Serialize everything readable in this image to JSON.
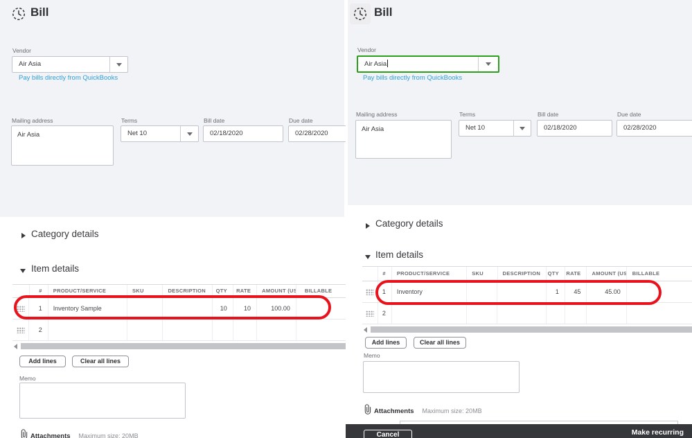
{
  "colors": {
    "highlight_red": "#e8121d",
    "focus_green": "#2ca01c",
    "link_blue": "#2f9fd9",
    "footer_bg": "#36373b",
    "panel_gray": "#f2f3f7"
  },
  "left": {
    "title": "Bill",
    "vendor_label": "Vendor",
    "vendor_value": "Air Asia",
    "pay_link": "Pay bills directly from QuickBooks",
    "mailing_label": "Mailing address",
    "mailing_value": "Air Asia",
    "terms_label": "Terms",
    "terms_value": "Net 10",
    "bill_date_label": "Bill date",
    "bill_date_value": "02/18/2020",
    "due_date_label": "Due date",
    "due_date_value": "02/28/2020",
    "category_details": "Category details",
    "item_details": "Item details",
    "table": {
      "headers": [
        "#",
        "PRODUCT/SERVICE",
        "SKU",
        "DESCRIPTION",
        "QTY",
        "RATE",
        "AMOUNT (US",
        "BILLABLE"
      ],
      "rows": [
        {
          "num": "1",
          "product": "Inventory Sample",
          "sku": "",
          "description": "",
          "qty": "10",
          "rate": "10",
          "amount": "100.00",
          "billable": ""
        },
        {
          "num": "2",
          "product": "",
          "sku": "",
          "description": "",
          "qty": "",
          "rate": "",
          "amount": "",
          "billable": ""
        }
      ]
    },
    "add_lines": "Add lines",
    "clear_all_lines": "Clear all lines",
    "memo_label": "Memo",
    "attachments_label": "Attachments",
    "attachments_hint": "Maximum size: 20MB"
  },
  "right": {
    "title": "Bill",
    "vendor_label": "Vendor",
    "vendor_value": "Air Asia",
    "pay_link": "Pay bills directly from QuickBooks",
    "mailing_label": "Mailing address",
    "mailing_value": "Air Asia",
    "terms_label": "Terms",
    "terms_value": "Net 10",
    "bill_date_label": "Bill date",
    "bill_date_value": "02/18/2020",
    "due_date_label": "Due date",
    "due_date_value": "02/28/2020",
    "category_details": "Category details",
    "item_details": "Item details",
    "table": {
      "headers": [
        "#",
        "PRODUCT/SERVICE",
        "SKU",
        "DESCRIPTION",
        "QTY",
        "RATE",
        "AMOUNT (US",
        "BILLABLE"
      ],
      "rows": [
        {
          "num": "1",
          "product": "Inventory",
          "sku": "",
          "description": "",
          "qty": "1",
          "rate": "45",
          "amount": "45.00",
          "billable": ""
        },
        {
          "num": "2",
          "product": "",
          "sku": "",
          "description": "",
          "qty": "",
          "rate": "",
          "amount": "",
          "billable": ""
        }
      ]
    },
    "add_lines": "Add lines",
    "clear_all_lines": "Clear all lines",
    "memo_label": "Memo",
    "attachments_label": "Attachments",
    "attachments_hint": "Maximum size: 20MB",
    "footer": {
      "cancel": "Cancel",
      "make_recurring": "Make recurring"
    }
  }
}
